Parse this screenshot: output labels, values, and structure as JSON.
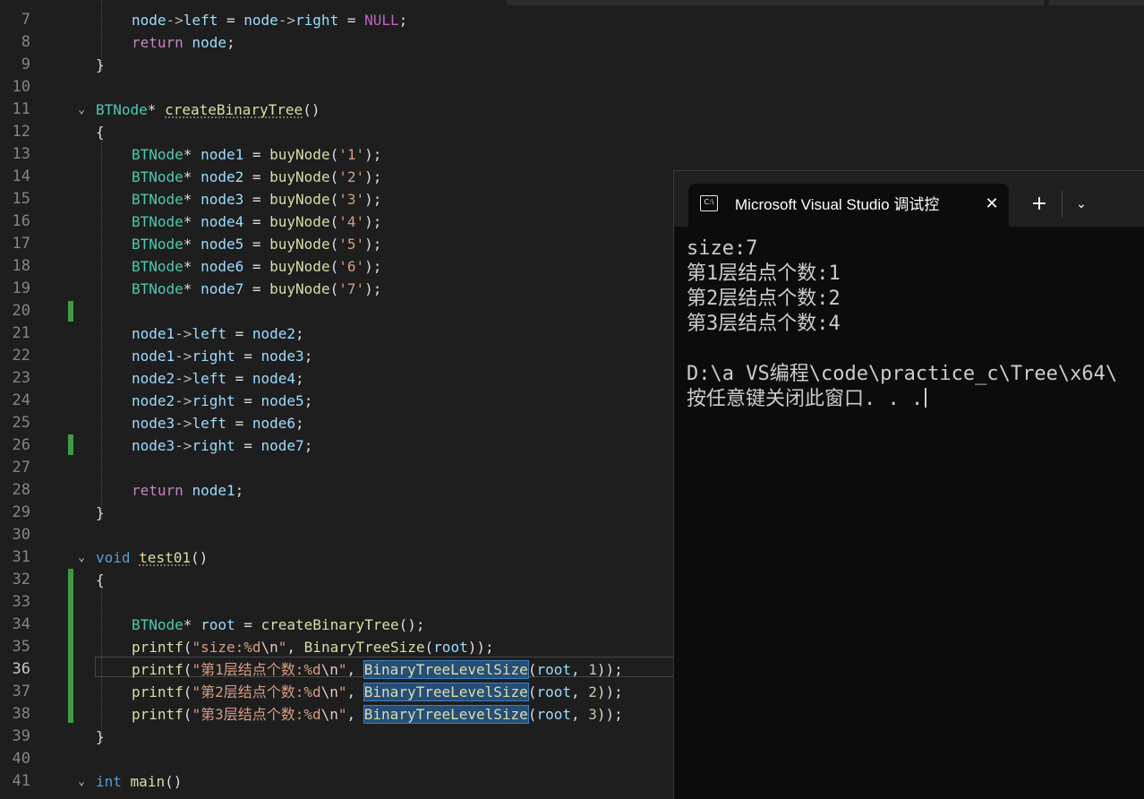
{
  "editor": {
    "current_line_number": "36",
    "line_numbers": [
      "7",
      "8",
      "9",
      "10",
      "11",
      "12",
      "13",
      "14",
      "15",
      "16",
      "17",
      "18",
      "19",
      "20",
      "21",
      "22",
      "23",
      "24",
      "25",
      "26",
      "27",
      "28",
      "29",
      "30",
      "31",
      "32",
      "33",
      "34",
      "35",
      "36",
      "37",
      "38",
      "39",
      "40",
      "41"
    ],
    "tokens": {
      "l7_node_a": "node",
      "l7_arrow_a": "->",
      "l7_left": "left",
      "l7_eq1": " = ",
      "l7_node_b": "node",
      "l7_arrow_b": "->",
      "l7_right": "right",
      "l7_eq2": " = ",
      "l7_null": "NULL",
      "l7_semi": ";",
      "l8_return": "return",
      "l8_node": " node",
      "l8_semi": ";",
      "l9_brace": "}",
      "l11_type": "BTNode",
      "l11_star": "* ",
      "l11_fn": "createBinaryTree",
      "l11_parens": "()",
      "l12_brace": "{",
      "btnode": "BTNode",
      "star": "* ",
      "assign": " = ",
      "buynode": "buyNode",
      "lparen": "(",
      "rparen": ")",
      "semi": ";",
      "node1": "node1",
      "node2": "node2",
      "node3": "node3",
      "node4": "node4",
      "node5": "node5",
      "node6": "node6",
      "node7": "node7",
      "c1": "'1'",
      "c2": "'2'",
      "c3": "'3'",
      "c4": "'4'",
      "c5": "'5'",
      "c6": "'6'",
      "c7": "'7'",
      "arrow": "->",
      "left": "left",
      "right": "right",
      "return": "return",
      "close_brace": "}",
      "open_brace": "{",
      "l31_void": "void",
      "l31_fn": "test01",
      "l31_parens": "()",
      "root": "root",
      "createbt_call": "createBinaryTree",
      "empty_parens": "()",
      "printf": "printf",
      "str_size_a": "\"size:%d",
      "esc_n": "\\n",
      "str_q": "\"",
      "comma": ", ",
      "binarytreesize": "BinaryTreeSize",
      "str_l1": "\"第1层结点个数:%d",
      "str_l2": "\"第2层结点个数:%d",
      "str_l3": "\"第3层结点个数:%d",
      "levelsize": "BinaryTreeLevelSize",
      "n1": "1",
      "n2": "2",
      "n3": "3",
      "close_call": "));",
      "l41_int": "int",
      "l41_main": "main",
      "l41_parens": "()"
    }
  },
  "console": {
    "tab_icon": "C:\\",
    "tab_title": "Microsoft Visual Studio 调试控",
    "close_glyph": "✕",
    "new_tab_glyph": "+",
    "dropdown_glyph": "⌄",
    "output_lines": [
      "size:7",
      "第1层结点个数:1",
      "第2层结点个数:2",
      "第3层结点个数:4",
      "",
      "D:\\a VS编程\\code\\practice_c\\Tree\\x64\\",
      "按任意键关闭此窗口. . ."
    ]
  },
  "icons": {
    "fold_glyph": "⌄",
    "terminal_tab_icon": "terminal-icon",
    "change_bar_color": "#3e9a43"
  }
}
